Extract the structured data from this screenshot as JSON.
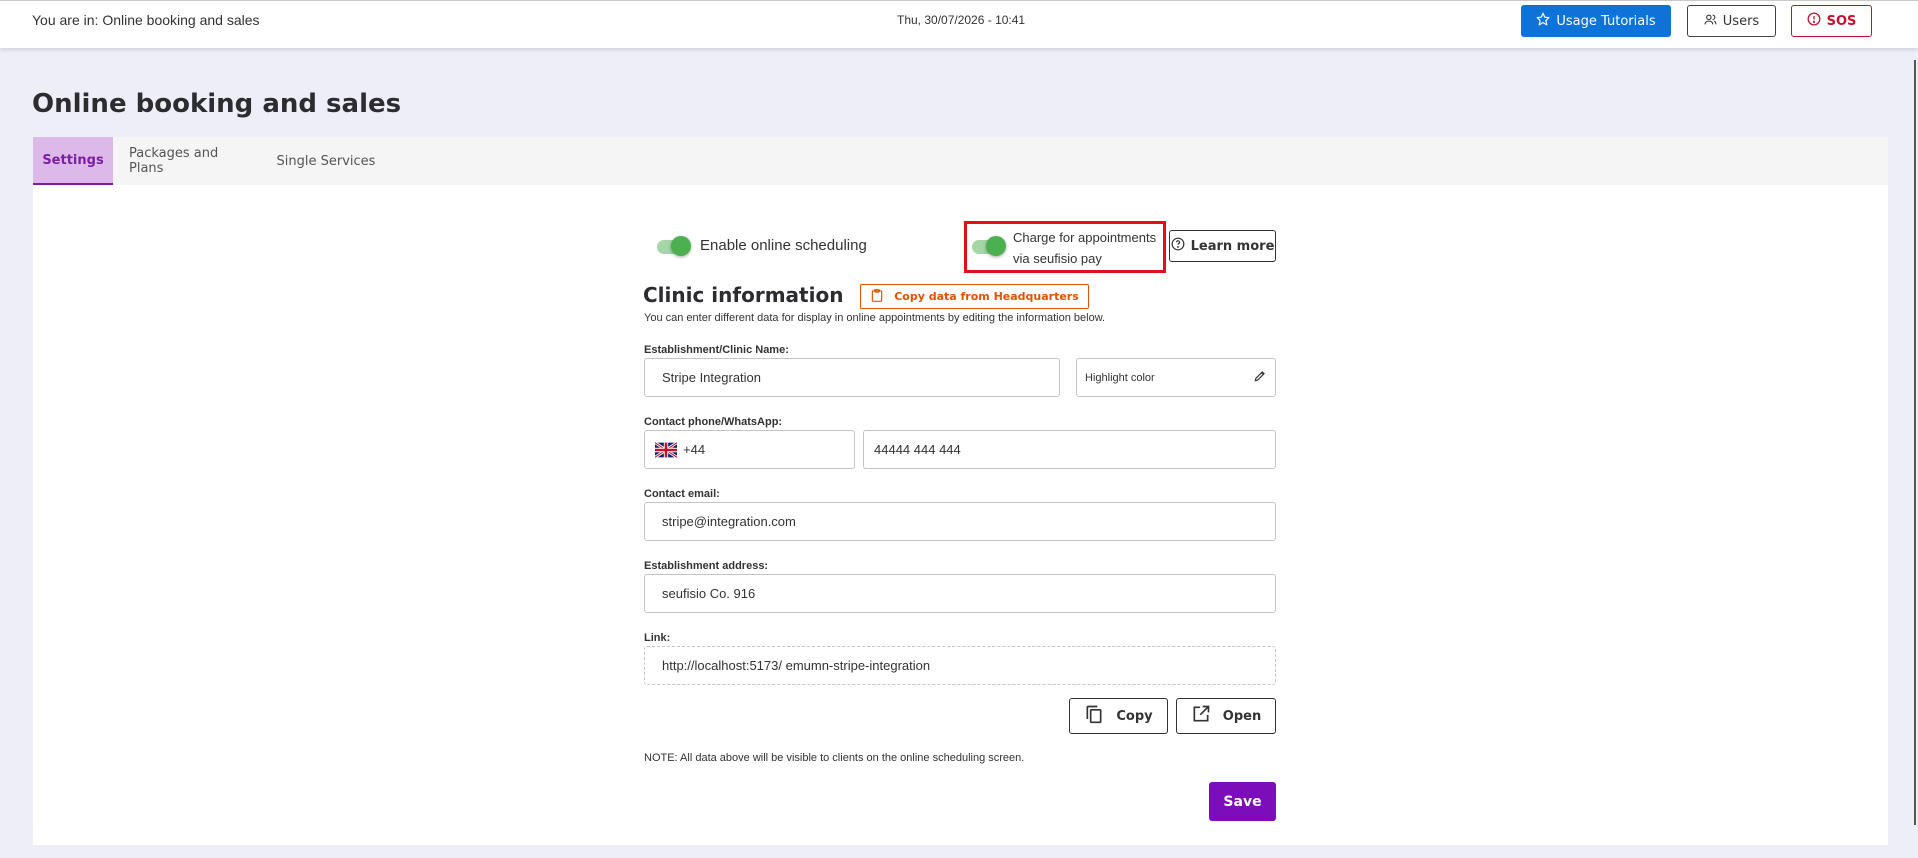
{
  "header": {
    "breadcrumb": "You are in: Online booking and sales",
    "datetime": "Thu, 30/07/2026 - 10:41",
    "buttons": {
      "tutorials": "Usage Tutorials",
      "users": "Users",
      "sos": "SOS"
    }
  },
  "page": {
    "title": "Online booking and sales",
    "tabs": [
      {
        "label": "Settings",
        "active": true
      },
      {
        "label": "Packages and Plans",
        "active": false
      },
      {
        "label": "Single Services",
        "active": false
      }
    ]
  },
  "settings": {
    "toggles": [
      {
        "label": "Enable online scheduling",
        "on": true
      },
      {
        "label_line1": "Charge for appointments",
        "label_line2": "via seufisio pay",
        "on": true,
        "highlighted": true
      }
    ],
    "learn_more": "Learn more",
    "clinic_title": "Clinic information",
    "copy_hq": "Copy data from Headquarters",
    "description": "You can enter different data for display in online appointments by editing the information below.",
    "fields": {
      "name_label": "Establishment/Clinic Name:",
      "name_value": "Stripe Integration",
      "highlight_color": "Highlight color",
      "phone_label": "Contact phone/WhatsApp:",
      "country_code": "+44",
      "phone_value": "44444 444 444",
      "email_label": "Contact email:",
      "email_value": "stripe@integration.com",
      "address_label": "Establishment address:",
      "address_value": "seufisio Co. 916",
      "link_label": "Link:",
      "link_value": "http://localhost:5173/ emumn-stripe-integration"
    },
    "copy_label": "Copy",
    "open_label": "Open",
    "note": "NOTE: All data above will be visible to clients on the online scheduling screen.",
    "save_label": "Save"
  },
  "colors": {
    "accent_purple": "#7b0dbb",
    "tab_active_bg": "#ddb9ea",
    "primary_blue": "#0d73d9",
    "danger_red": "#c8102e",
    "toggle_green": "#4caf50",
    "copy_hq_orange": "#e65100",
    "highlight_red": "#e0101a"
  },
  "icons": {
    "tutorials": "star-icon",
    "users": "users-icon",
    "sos": "alert-circle-icon",
    "learn_more": "help-circle-icon",
    "copy_hq": "clipboard-icon",
    "highlight_color": "pencil-icon",
    "country": "uk-flag-icon",
    "copy": "copy-icon",
    "open": "external-link-icon"
  }
}
